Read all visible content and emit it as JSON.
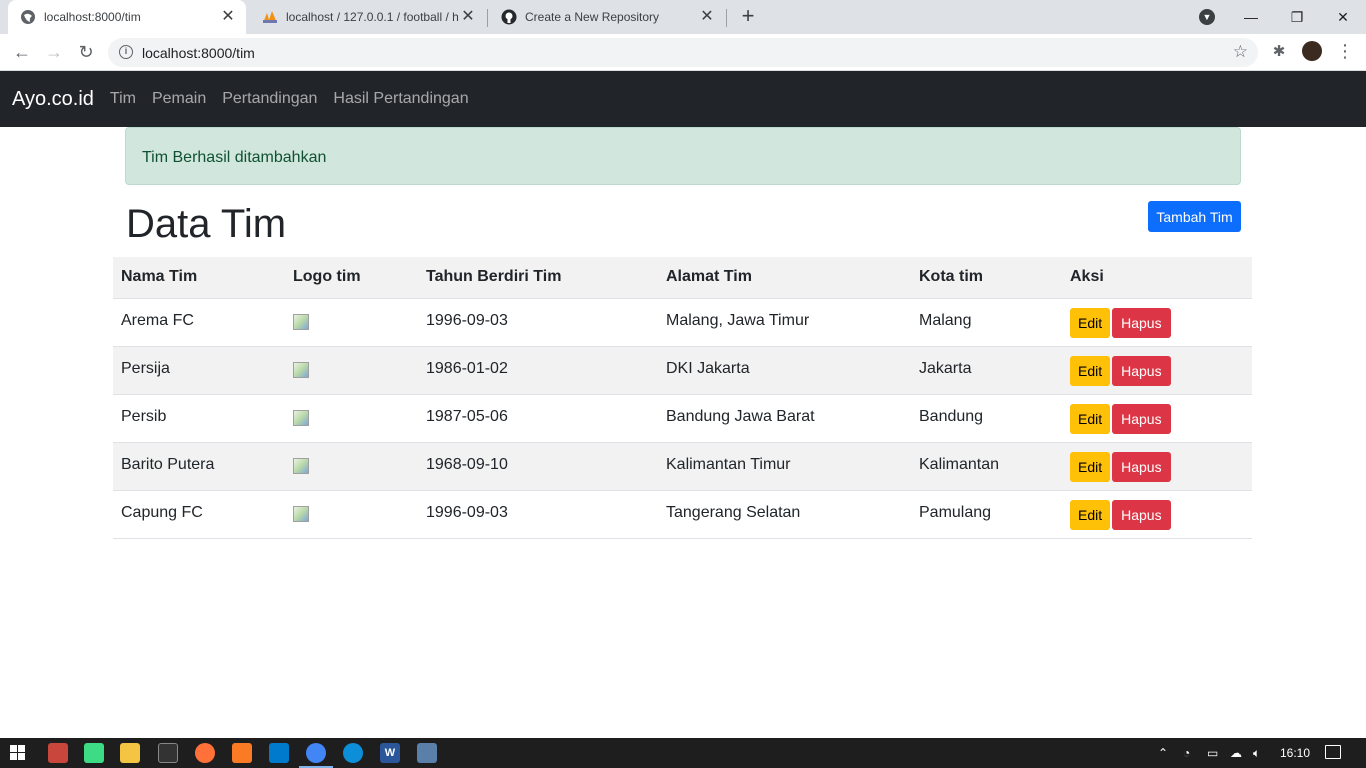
{
  "browser": {
    "tabs": [
      {
        "title": "localhost:8000/tim",
        "active": true,
        "icon": "globe-icon"
      },
      {
        "title": "localhost / 127.0.0.1 / football / h",
        "active": false,
        "icon": "phpmyadmin-icon"
      },
      {
        "title": "Create a New Repository",
        "active": false,
        "icon": "github-icon"
      }
    ],
    "url": "localhost:8000/tim"
  },
  "app": {
    "brand": "Ayo.co.id",
    "nav": [
      "Tim",
      "Pemain",
      "Pertandingan",
      "Hasil Pertandingan"
    ]
  },
  "alert": {
    "message": "Tim Berhasil ditambahkan",
    "color": "#d1e7dd"
  },
  "page": {
    "title": "Data Tim",
    "add_button": "Tambah Tim"
  },
  "table": {
    "headers": [
      "Nama Tim",
      "Logo tim",
      "Tahun Berdiri Tim",
      "Alamat Tim",
      "Kota tim",
      "Aksi"
    ],
    "rows": [
      {
        "nama": "Arema FC",
        "tahun": "1996-09-03",
        "alamat": "Malang, Jawa Timur",
        "kota": "Malang"
      },
      {
        "nama": "Persija",
        "tahun": "1986-01-02",
        "alamat": "DKI Jakarta",
        "kota": "Jakarta"
      },
      {
        "nama": "Persib",
        "tahun": "1987-05-06",
        "alamat": "Bandung Jawa Barat",
        "kota": "Bandung"
      },
      {
        "nama": "Barito Putera",
        "tahun": "1968-09-10",
        "alamat": "Kalimantan Timur",
        "kota": "Kalimantan"
      },
      {
        "nama": "Capung FC",
        "tahun": "1996-09-03",
        "alamat": "Tangerang Selatan",
        "kota": "Pamulang"
      }
    ],
    "edit_label": "Edit",
    "delete_label": "Hapus"
  },
  "taskbar": {
    "clock": "16:10"
  },
  "colors": {
    "navbar": "#212529",
    "primary": "#0d6efd",
    "warning": "#ffc107",
    "danger": "#dc3545"
  }
}
